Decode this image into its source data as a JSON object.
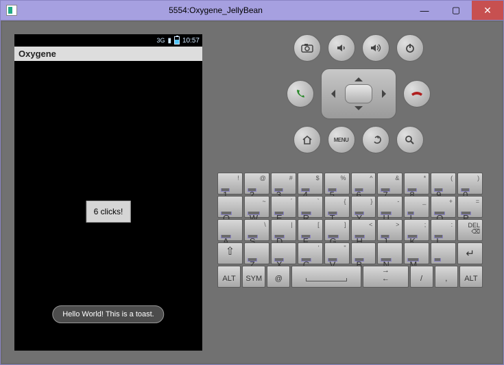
{
  "window": {
    "title": "5554:Oxygene_JellyBean"
  },
  "phone": {
    "statusbar": {
      "network_label": "3G",
      "time": "10:57"
    },
    "app_title": "Oxygene",
    "button_text": "6 clicks!",
    "toast_text": "Hello World! This is a toast."
  },
  "hw": {
    "menu_label": "MENU"
  },
  "keyboard": {
    "row1": [
      {
        "m": "1",
        "s": "!"
      },
      {
        "m": "2",
        "s": "@"
      },
      {
        "m": "3",
        "s": "#"
      },
      {
        "m": "4",
        "s": "$"
      },
      {
        "m": "5",
        "s": "%"
      },
      {
        "m": "6",
        "s": "^"
      },
      {
        "m": "7",
        "s": "&"
      },
      {
        "m": "8",
        "s": "*"
      },
      {
        "m": "9",
        "s": "("
      },
      {
        "m": "0",
        "s": ")"
      }
    ],
    "row2": [
      {
        "m": "Q",
        "s": ""
      },
      {
        "m": "W",
        "s": "~"
      },
      {
        "m": "E",
        "s": "´"
      },
      {
        "m": "R",
        "s": "`"
      },
      {
        "m": "T",
        "s": "{"
      },
      {
        "m": "Y",
        "s": "}"
      },
      {
        "m": "U",
        "s": "-"
      },
      {
        "m": "I",
        "s": "_"
      },
      {
        "m": "O",
        "s": "+"
      },
      {
        "m": "P",
        "s": "="
      }
    ],
    "row3": [
      {
        "m": "A",
        "s": ""
      },
      {
        "m": "S",
        "s": "\\"
      },
      {
        "m": "D",
        "s": "|"
      },
      {
        "m": "F",
        "s": "["
      },
      {
        "m": "G",
        "s": "]"
      },
      {
        "m": "H",
        "s": "<"
      },
      {
        "m": "J",
        "s": ">"
      },
      {
        "m": "K",
        "s": ";"
      },
      {
        "m": "L",
        "s": ":"
      }
    ],
    "row3_del": "DEL",
    "row4": [
      {
        "m": "Z",
        "s": ""
      },
      {
        "m": "X",
        "s": ""
      },
      {
        "m": "C",
        "s": "'"
      },
      {
        "m": "V",
        "s": "\""
      },
      {
        "m": "B",
        "s": ""
      },
      {
        "m": "N",
        "s": ""
      },
      {
        "m": "M",
        "s": ""
      },
      {
        "m": ".",
        "s": ""
      }
    ],
    "row5": {
      "alt": "ALT",
      "sym": "SYM",
      "at": "@",
      "slash": "/",
      "comma": ",",
      "alt2": "ALT"
    }
  }
}
